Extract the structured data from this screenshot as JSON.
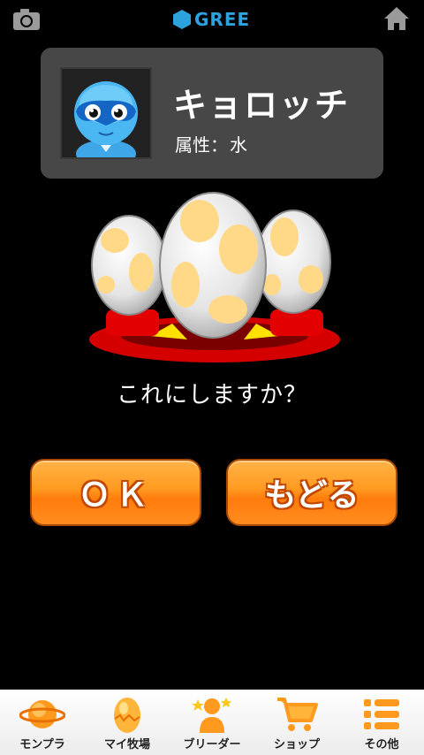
{
  "header": {
    "logo_text": "GREE",
    "camera_icon": "camera-icon",
    "home_icon": "home-icon"
  },
  "monster": {
    "name": "キョロッチ",
    "attribute_label": "属性：",
    "attribute_value": "水"
  },
  "prompt": "これにしますか？",
  "buttons": {
    "ok_label": "ＯＫ",
    "back_label": "もどる"
  },
  "bottom_nav": {
    "items": [
      {
        "label": "モンプラ",
        "icon": "planet-icon"
      },
      {
        "label": "マイ牧場",
        "icon": "egg-icon"
      },
      {
        "label": "ブリーダー",
        "icon": "breeder-icon"
      },
      {
        "label": "ショップ",
        "icon": "cart-icon"
      },
      {
        "label": "その他",
        "icon": "menu-list-icon"
      }
    ]
  },
  "colors": {
    "gree_blue": "#2da3dd",
    "button_orange": "#ff8d1f",
    "card_gray": "#474747"
  }
}
